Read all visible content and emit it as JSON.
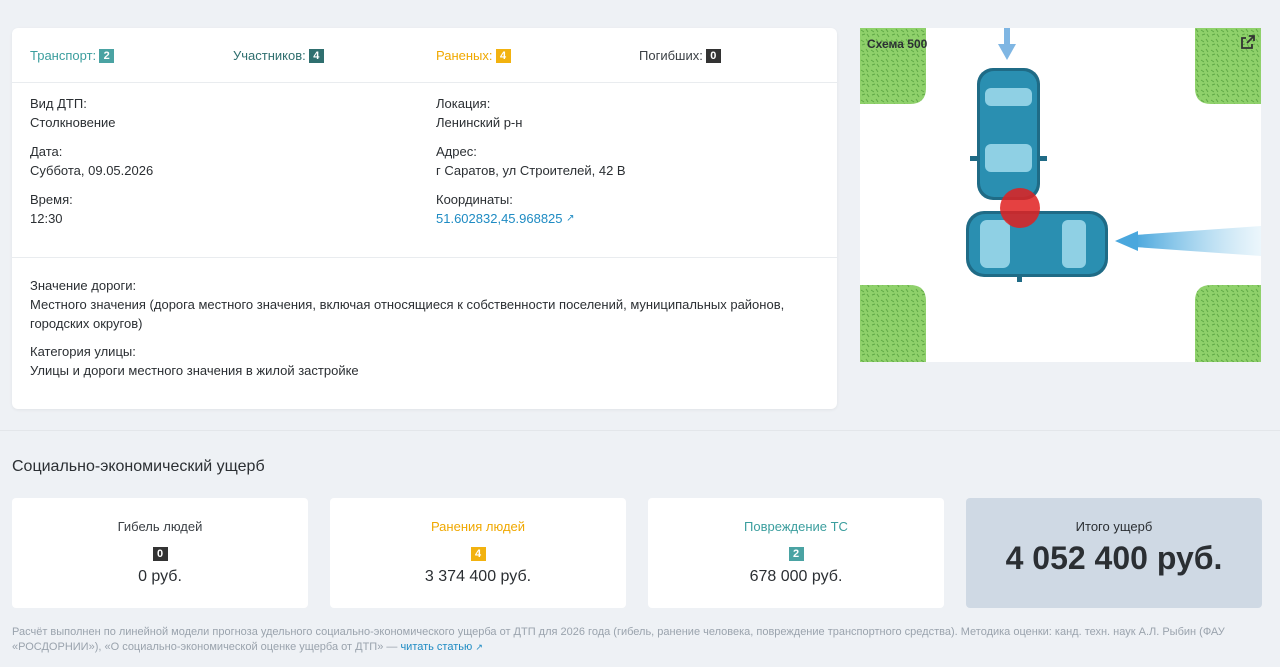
{
  "stats": {
    "transport": {
      "label": "Транспорт:",
      "count": "2"
    },
    "participants": {
      "label": "Участников:",
      "count": "4"
    },
    "injured": {
      "label": "Раненых:",
      "count": "4"
    },
    "dead": {
      "label": "Погибших:",
      "count": "0"
    }
  },
  "details": {
    "type": {
      "label": "Вид ДТП:",
      "value": "Столкновение"
    },
    "date": {
      "label": "Дата:",
      "value": "Суббота, 09.05.2026"
    },
    "time": {
      "label": "Время:",
      "value": "12:30"
    },
    "location": {
      "label": "Локация:",
      "value": "Ленинский р-н"
    },
    "address": {
      "label": "Адрес:",
      "value": "г Саратов, ул Строителей, 42 В"
    },
    "coords": {
      "label": "Координаты:",
      "value": "51.602832,45.968825"
    },
    "road_value": {
      "label": "Значение дороги:",
      "line1": "Местного значения (дорога местного значения, включая относящиеся к собственности поселений, муниципальных районов,",
      "line2": "городских округов)"
    },
    "street_cat": {
      "label": "Категория улицы:",
      "value": "Улицы и дороги местного значения в жилой застройке"
    }
  },
  "scheme": {
    "title": "Схема 500"
  },
  "damage": {
    "title": "Социально-экономический ущерб",
    "death": {
      "title": "Гибель людей",
      "count": "0",
      "sum": "0 руб."
    },
    "injury": {
      "title": "Ранения людей",
      "count": "4",
      "sum": "3 374 400 руб."
    },
    "vehicle": {
      "title": "Повреждение ТС",
      "count": "2",
      "sum": "678 000 руб."
    },
    "total": {
      "title": "Итого ущерб",
      "sum": "4 052 400 руб."
    }
  },
  "footer": {
    "line1": "Расчёт выполнен по линейной модели прогноза удельного социально-экономического ущерба от ДТП для 2026 года (гибель, ранение человека, повреждение транспортного средства). Методика оценки: канд. техн. наук А.Л. Рыбин (ФАУ",
    "line2": "«РОСДОРНИИ»), «О социально-экономической оценке ущерба от ДТП» —",
    "link": "читать статью"
  },
  "colors": {
    "teal": "#4aa3a3",
    "dark_teal": "#2f6f6f",
    "orange": "#f2b20f",
    "link": "#1e8bc3"
  }
}
